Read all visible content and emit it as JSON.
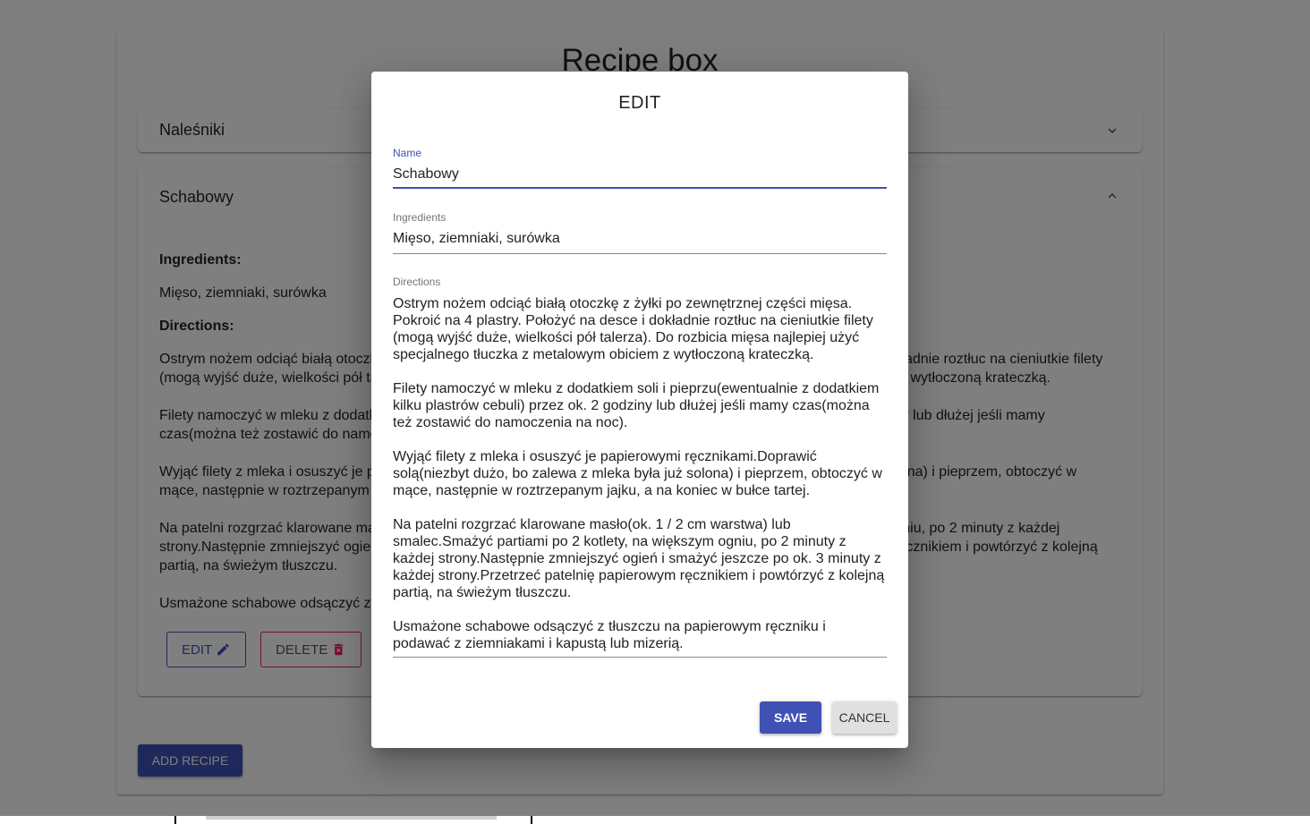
{
  "app": {
    "title": "Recipe box"
  },
  "recipes": [
    {
      "name": "Naleśniki",
      "expanded": false
    },
    {
      "name": "Schabowy",
      "expanded": true,
      "ingredients_heading": "Ingredients:",
      "ingredients": "Mięso, ziemniaki, surówka",
      "directions_heading": "Directions:",
      "directions": [
        "Ostrym nożem odciąć białą otoczkę z żyłki po zewnętrznej części mięsa. Pokroić na 4 plastry. Położyć na desce i dokładnie roztłuc na cieniutkie filety (mogą wyjść duże, wielkości pół talerza). Do rozbicia mięsa najlepiej użyć specjalnego tłuczka z metalowym obiciem z wytłoczoną krateczką.",
        "Filety namoczyć w mleku z dodatkiem soli i pieprzu(ewentualnie z dodatkiem kilku plastrów cebuli) przez ok. 2 godziny lub dłużej jeśli mamy czas(można też zostawić do namoczenia na noc).",
        "Wyjąć filety z mleka i osuszyć je papierowymi ręcznikami.Doprawić solą(niezbyt dużo, bo zalewa z mleka była już solona) i pieprzem, obtoczyć w mące, następnie w roztrzepanym jajku, a na koniec w bułce tartej.",
        "Na patelni rozgrzać klarowane masło(ok. 1 / 2 cm warstwa) lub smalec.Smażyć partiami po 2 kotlety, na większym ogniu, po 2 minuty z każdej strony.Następnie zmniejszyć ogień i smażyć jeszcze po ok. 3 minuty z każdej strony.Przetrzeć patelnię papierowym ręcznikiem i powtórzyć z kolejną partią, na świeżym tłuszczu.",
        "Usmażone schabowe odsączyć z tłuszczu na papierowym ręczniku i podawać z ziemniakami i kapustą lub mizerią."
      ],
      "edit_label": "EDIT",
      "delete_label": "DELETE"
    }
  ],
  "add_recipe_label": "ADD RECIPE",
  "dialog": {
    "title": "EDIT",
    "name_label": "Name",
    "name_value": "Schabowy",
    "ingredients_label": "Ingredients",
    "ingredients_value": "Mięso, ziemniaki, surówka",
    "directions_label": "Directions",
    "directions_paragraphs": [
      "Ostrym nożem odciąć białą otoczkę z żyłki po zewnętrznej części mięsa. Pokroić na 4 plastry. Położyć na desce i dokładnie roztłuc na cieniutkie filety (mogą wyjść duże, wielkości pół talerza). Do rozbicia mięsa najlepiej użyć specjalnego tłuczka z metalowym obiciem z wytłoczoną krateczką.",
      "Filety namoczyć w mleku z dodatkiem soli i pieprzu(ewentualnie z dodatkiem kilku plastrów cebuli) przez ok. 2 godziny lub dłużej jeśli mamy czas(można też zostawić do namoczenia na noc).",
      "Wyjąć filety z mleka i osuszyć je papierowymi ręcznikami.Doprawić solą(niezbyt dużo, bo zalewa z mleka była już solona) i pieprzem, obtoczyć w mące, następnie w roztrzepanym jajku, a na koniec w bułce tartej.",
      "Na patelni rozgrzać klarowane masło(ok. 1 / 2 cm warstwa) lub smalec.Smażyć partiami po 2 kotlety, na większym ogniu, po 2 minuty z każdej strony.Następnie zmniejszyć ogień i smażyć jeszcze po ok. 3 minuty z każdej strony.Przetrzeć patelnię papierowym ręcznikiem i powtórzyć z kolejną partią, na świeżym tłuszczu.",
      "Usmażone schabowe odsączyć z tłuszczu na papierowym ręczniku i podawać z ziemniakami i kapustą lub mizerią."
    ],
    "save_label": "SAVE",
    "cancel_label": "CANCEL"
  },
  "icons": {
    "panel_1_toggle": "chevron-down-icon",
    "panel_2_toggle": "chevron-up-icon",
    "edit": "pencil-icon",
    "delete": "trash-icon"
  },
  "colors": {
    "primary": "#3f51b5",
    "secondary": "#e91e63",
    "backdrop": "rgba(0,0,0,0.5)"
  }
}
